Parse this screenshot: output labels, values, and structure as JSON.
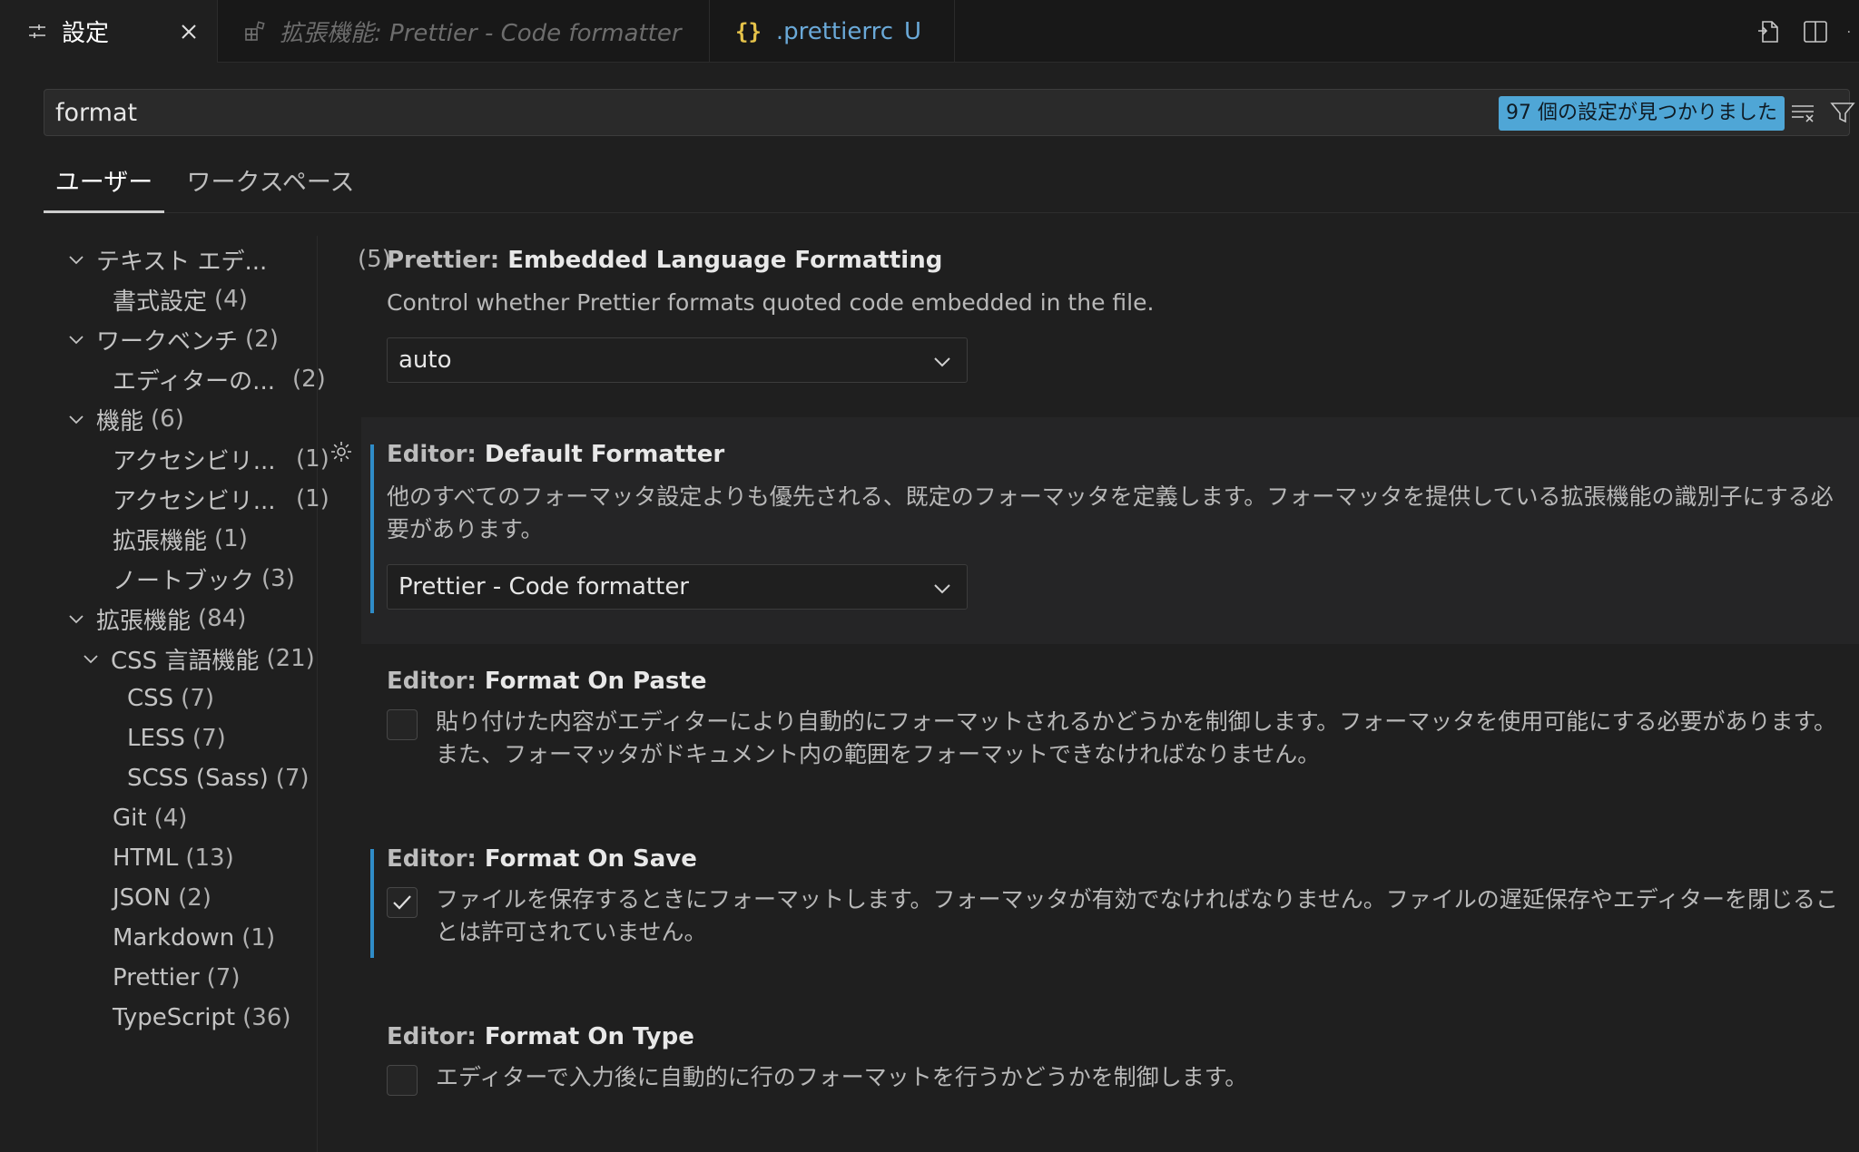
{
  "tabs": {
    "settings": {
      "label": "設定"
    },
    "extension": {
      "label": "拡張機能: Prettier - Code formatter"
    },
    "prettierrc": {
      "label": ".prettierrc",
      "badge": "U"
    }
  },
  "search": {
    "value": "format",
    "result_count": "97 個の設定が見つかりました"
  },
  "scope_tabs": {
    "user": "ユーザー",
    "workspace": "ワークスペース"
  },
  "toc": {
    "text_editor": {
      "label": "テキスト エデ...",
      "count": "(5)"
    },
    "formatting": {
      "label": "書式設定",
      "count": "(4)"
    },
    "workbench": {
      "label": "ワークベンチ",
      "count": "(2)"
    },
    "editor_mgmt": {
      "label": "エディターの...",
      "count": "(2)"
    },
    "features": {
      "label": "機能",
      "count": "(6)"
    },
    "accessibility1": {
      "label": "アクセシビリ...",
      "count": "(1)"
    },
    "accessibility2": {
      "label": "アクセシビリ...",
      "count": "(1)"
    },
    "extensions_feat": {
      "label": "拡張機能",
      "count": "(1)"
    },
    "notebook": {
      "label": "ノートブック",
      "count": "(3)"
    },
    "extensions": {
      "label": "拡張機能",
      "count": "(84)"
    },
    "css_lang": {
      "label": "CSS 言語機能",
      "count": "(21)"
    },
    "css": {
      "label": "CSS",
      "count": "(7)"
    },
    "less": {
      "label": "LESS",
      "count": "(7)"
    },
    "scss": {
      "label": "SCSS (Sass)",
      "count": "(7)"
    },
    "git": {
      "label": "Git",
      "count": "(4)"
    },
    "html": {
      "label": "HTML",
      "count": "(13)"
    },
    "json": {
      "label": "JSON",
      "count": "(2)"
    },
    "markdown": {
      "label": "Markdown",
      "count": "(1)"
    },
    "prettier": {
      "label": "Prettier",
      "count": "(7)"
    },
    "typescript": {
      "label": "TypeScript",
      "count": "(36)"
    }
  },
  "settings": {
    "embedded": {
      "category": "Prettier: ",
      "name": "Embedded Language Formatting",
      "description": "Control whether Prettier formats quoted code embedded in the file.",
      "value": "auto"
    },
    "default_formatter": {
      "category": "Editor: ",
      "name": "Default Formatter",
      "description": "他のすべてのフォーマッタ設定よりも優先される、既定のフォーマッタを定義します。フォーマッタを提供している拡張機能の識別子にする必要があります。",
      "value": "Prettier - Code formatter"
    },
    "format_on_paste": {
      "category": "Editor: ",
      "name": "Format On Paste",
      "description": "貼り付けた内容がエディターにより自動的にフォーマットされるかどうかを制御します。フォーマッタを使用可能にする必要があります。また、フォーマッタがドキュメント内の範囲をフォーマットできなければなりません。",
      "checked": false
    },
    "format_on_save": {
      "category": "Editor: ",
      "name": "Format On Save",
      "description": "ファイルを保存するときにフォーマットします。フォーマッタが有効でなければなりません。ファイルの遅延保存やエディターを閉じることは許可されていません。",
      "checked": true
    },
    "format_on_type": {
      "category": "Editor: ",
      "name": "Format On Type",
      "description": "エディターで入力後に自動的に行のフォーマットを行うかどうかを制御します。",
      "checked": false
    }
  },
  "colors": {
    "accent": "#2f8cc8",
    "badge": "#4fa6d6",
    "rc_tab": "#6aa9d8"
  }
}
